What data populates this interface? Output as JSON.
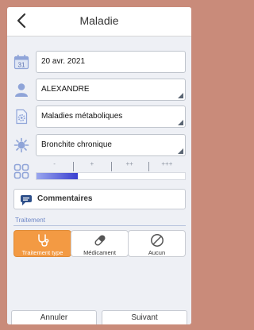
{
  "header": {
    "title": "Maladie",
    "back_icon": "chevron-left-icon"
  },
  "form": {
    "date": {
      "value": "20 avr. 2021",
      "icon": "calendar-icon",
      "icon_text": "31"
    },
    "patient": {
      "value": "ALEXANDRE",
      "icon": "person-icon"
    },
    "category": {
      "value": "Maladies métaboliques",
      "icon": "document-gear-icon"
    },
    "disease": {
      "value": "Bronchite chronique",
      "icon": "virus-icon"
    },
    "severity": {
      "icon": "grid-icon",
      "levels": [
        "-",
        "+",
        "++",
        "+++"
      ],
      "selected_index": 0,
      "fill_fraction": 0.28
    }
  },
  "comments": {
    "label": "Commentaires",
    "icon": "speech-bubble-icon"
  },
  "treatment": {
    "section_label": "Traitement",
    "options": [
      {
        "label": "Traitement type",
        "icon": "stethoscope-icon",
        "active": true
      },
      {
        "label": "Médicament",
        "icon": "pill-icon",
        "active": false
      },
      {
        "label": "Aucun",
        "icon": "no-entry-icon",
        "active": false
      }
    ]
  },
  "footer": {
    "cancel_label": "Annuler",
    "next_label": "Suivant"
  },
  "colors": {
    "accent": "#f39a43",
    "icon_blue": "#8fa4d8",
    "severity_fill": "#3a3fd0",
    "section_label": "#6f88c7",
    "frame": "#c98b7a"
  }
}
